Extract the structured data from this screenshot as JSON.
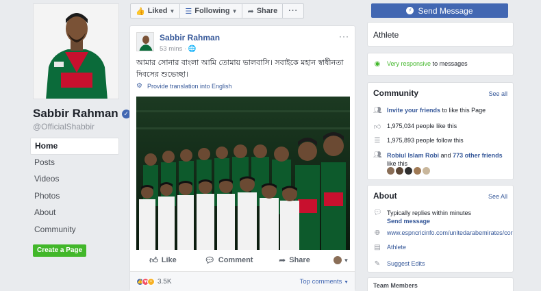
{
  "left": {
    "page_name": "Sabbir Rahman",
    "handle": "@OfficialShabbir",
    "nav": [
      "Home",
      "Posts",
      "Videos",
      "Photos",
      "About",
      "Community"
    ],
    "create_page": "Create a Page"
  },
  "actionbar": {
    "liked": "Liked",
    "following": "Following",
    "share": "Share",
    "more": "···"
  },
  "post": {
    "author": "Sabbir Rahman",
    "time": "53 mins",
    "text": "আমার সোনার বাংলা আমি তোমায় ভালবাসি। সবাইকে মহান স্বাধীনতা দিবসের শুভেচ্ছা।",
    "translate": "Provide translation into English",
    "like": "Like",
    "comment": "Comment",
    "share": "Share",
    "reaction_count": "3.5K",
    "top_comments": "Top comments"
  },
  "right": {
    "send_message": "Send Message",
    "category": "Athlete",
    "responsive": "Very responsive",
    "responsive_suffix": "to messages",
    "community": {
      "title": "Community",
      "see_all": "See all",
      "invite_link": "Invite your friends",
      "invite_suffix": "to like this Page",
      "likes": "1,975,034 people like this",
      "follows": "1,975,893 people follow this",
      "friend_name": "Robiul Islam Robi",
      "friend_and": "and",
      "friend_others": "773 other friends",
      "friend_suffix": "like this"
    },
    "about": {
      "title": "About",
      "see_all": "See All",
      "replies": "Typically replies within minutes",
      "send_message": "Send message",
      "website": "www.espncricinfo.com/unitedarabemirates/cor",
      "category": "Athlete",
      "suggest": "Suggest Edits"
    },
    "team_members": "Team Members"
  },
  "colors": {
    "brand_blue": "#4267b2",
    "link_blue": "#365899",
    "green": "#42b72a",
    "page_bg": "#e9ebee"
  },
  "icons": {
    "liked": "thumbs-up-icon",
    "following": "rss-icon",
    "share": "share-arrow-icon",
    "messenger": "messenger-icon",
    "globe": "globe-icon",
    "gear": "gear-icon",
    "verified": "verified-badge-icon"
  }
}
